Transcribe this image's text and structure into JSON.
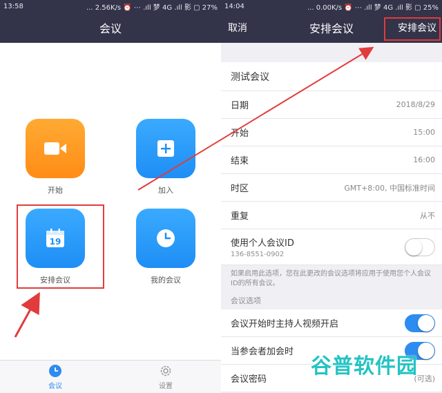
{
  "left": {
    "status": {
      "time": "13:58",
      "right": "... 2.56K/s ⏰ ⋯ .ıll 梦 4G .ıll 影 ▢ 27%"
    },
    "title": "会议",
    "tiles": [
      {
        "label": "开始",
        "icon": "video-camera-icon",
        "color": "orange"
      },
      {
        "label": "加入",
        "icon": "plus-icon",
        "color": "blue"
      },
      {
        "label": "安排会议",
        "icon": "calendar-icon",
        "color": "blue",
        "calendar_day": "19"
      },
      {
        "label": "我的会议",
        "icon": "clock-icon",
        "color": "blue"
      }
    ],
    "tabs": [
      {
        "label": "会议",
        "icon": "clock-icon",
        "active": true
      },
      {
        "label": "设置",
        "icon": "gear-icon",
        "active": false
      }
    ]
  },
  "right": {
    "status": {
      "time": "14:04",
      "right": "... 0.00K/s ⏰ ⋯ .ıll 梦 4G .ıll 影 ▢ 25%"
    },
    "nav": {
      "cancel": "取消",
      "title": "安排会议",
      "schedule": "安排会议"
    },
    "topic": "测试会议",
    "rows": [
      {
        "label": "日期",
        "value": "2018/8/29"
      },
      {
        "label": "开始",
        "value": "15:00"
      },
      {
        "label": "结束",
        "value": "16:00"
      },
      {
        "label": "时区",
        "value": "GMT+8:00, 中国标准时间"
      },
      {
        "label": "重复",
        "value": "从不"
      }
    ],
    "pmi": {
      "label": "使用个人会议ID",
      "id": "136-8551-0902",
      "on": false
    },
    "pmi_note": "如果启用此选项，您在此更改的会议选项将应用于使用您个人会议ID的所有会议。",
    "section_title": "会议选项",
    "options": [
      {
        "label": "会议开始时主持人视频开启",
        "on": true
      },
      {
        "label": "当参会者加会时",
        "on": true
      }
    ],
    "password": {
      "label": "会议密码",
      "value": "(可选)"
    }
  },
  "watermark": "谷普软件园",
  "colors": {
    "header": "#33334a",
    "accent": "#2d8cf0",
    "orange": "#ff8c16",
    "highlight": "#e23b3b"
  }
}
